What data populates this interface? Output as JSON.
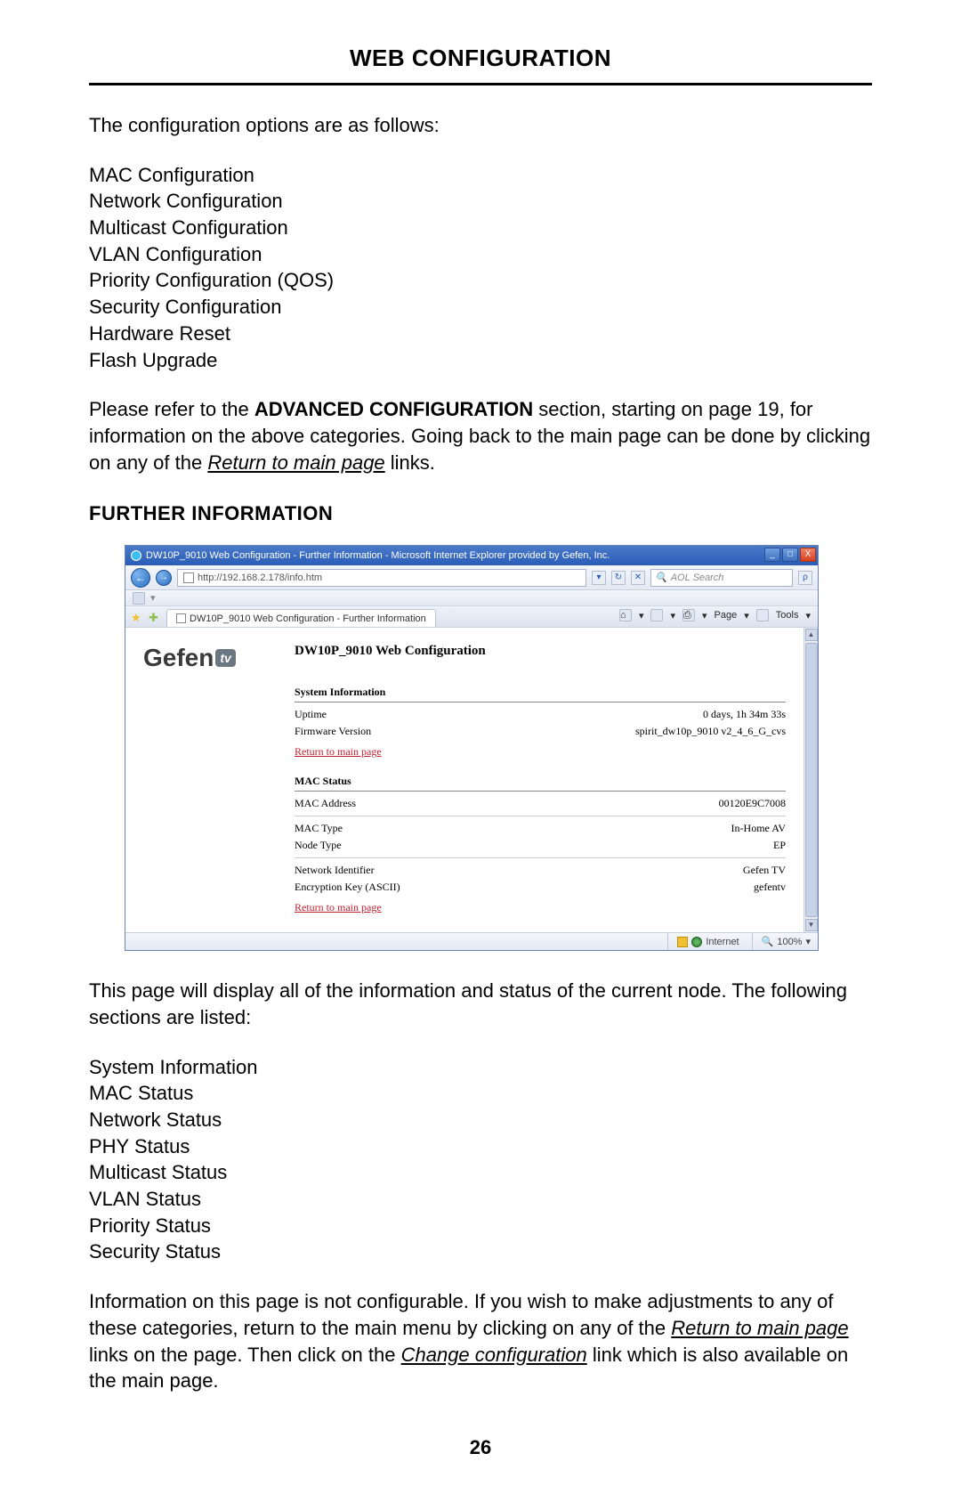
{
  "page": {
    "title": "WEB CONFIGURATION",
    "intro": "The configuration options are as follows:",
    "config_options": [
      "MAC Configuration",
      "Network Configuration",
      "Multicast Configuration",
      "VLAN Configuration",
      "Priority Configuration (QOS)",
      "Security Configuration",
      "Hardware Reset",
      "Flash Upgrade"
    ],
    "refer_pre": "Please refer to the ",
    "refer_bold": "ADVANCED CONFIGURATION",
    "refer_mid": " section, starting on page 19, for information on the above categories. Going back to the main page can be done by clicking on any of the ",
    "refer_link": "Return to main page",
    "refer_post": " links.",
    "section_head": "FURTHER INFORMATION",
    "desc1": "This page will display all of the information and status of the current node. The following sections are listed:",
    "status_sections": [
      "System Information",
      "MAC Status",
      "Network Status",
      "PHY Status",
      "Multicast Status",
      "VLAN Status",
      "Priority Status",
      "Security Status"
    ],
    "foot_pre": "Information on this page is not configurable. If you wish to make adjustments to any of these categories, return to the main menu by clicking on any of the ",
    "foot_link1": "Return to main page",
    "foot_mid": " links on the page. Then click on the ",
    "foot_link2": "Change configuration",
    "foot_post": " link which is also available on the main page.",
    "page_number": "26"
  },
  "shot": {
    "title": "DW10P_9010 Web Configuration - Further Information - Microsoft Internet Explorer provided by Gefen, Inc.",
    "url": "http://192.168.2.178/info.htm",
    "search_placeholder": "AOL Search",
    "tab_label": "DW10P_9010 Web Configuration - Further Information",
    "tool_page": "Page",
    "tool_tools": "Tools",
    "logo_text": "Gefen",
    "logo_tv": "tv",
    "cfg_title": "DW10P_9010 Web Configuration",
    "sys_info_hdr": "System Information",
    "uptime_label": "Uptime",
    "uptime_val": "0 days, 1h 34m 33s",
    "fw_label": "Firmware Version",
    "fw_val": "spirit_dw10p_9010 v2_4_6_G_cvs",
    "return_link": "Return to main page",
    "mac_hdr": "MAC Status",
    "mac_addr_label": "MAC Address",
    "mac_addr_val": "00120E9C7008",
    "mac_type_label": "MAC Type",
    "mac_type_val": "In-Home AV",
    "node_type_label": "Node Type",
    "node_type_val": "EP",
    "net_id_label": "Network Identifier",
    "net_id_val": "Gefen TV",
    "enc_label": "Encryption Key (ASCII)",
    "enc_val": "gefentv",
    "status_internet": "Internet",
    "status_zoom": "100%",
    "win_min": "_",
    "win_max": "□",
    "win_close": "X",
    "refresh": "↻",
    "dropdown": "▾",
    "search_go": "🔍",
    "back": "←",
    "fwd": "→",
    "star": "★",
    "plus": "✚",
    "home": "⌂",
    "print": "⎙",
    "up": "▲",
    "down": "▼"
  }
}
